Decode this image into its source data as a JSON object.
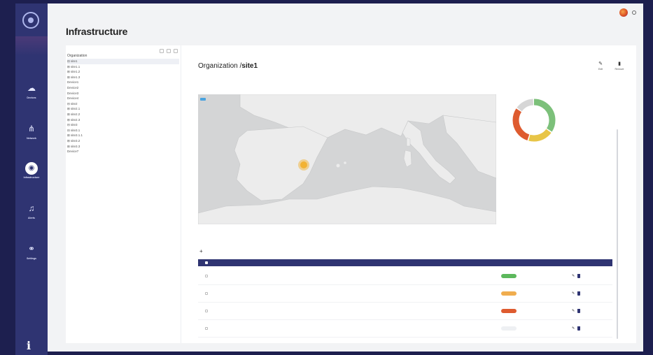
{
  "colors": {
    "sidebar": "#2f3472",
    "background": "#1d1f4f",
    "accent_navy": "#2f3472",
    "status_green": "#5cb85c",
    "status_orange": "#f0ad4e",
    "status_red": "#d9534f",
    "status_gray": "#e5e7eb",
    "donut_green": "#7cc07a",
    "donut_yellow": "#e8c547",
    "donut_red": "#de5b2f",
    "donut_gray": "#d6d6d6",
    "marker": "#f2b233"
  },
  "sidebar": {
    "logo_icon": "atom-icon",
    "items": [
      {
        "label": "Devices",
        "icon": "cloud-icon"
      },
      {
        "label": "Network",
        "icon": "topology-icon"
      },
      {
        "label": "Infrastructure",
        "icon": "globe-icon",
        "active": true
      },
      {
        "label": "Alerts",
        "icon": "bell-icon"
      },
      {
        "label": "Settings",
        "icon": "link-icon"
      }
    ],
    "info_label": "i"
  },
  "page": {
    "title": "Infrastructure"
  },
  "tree": {
    "root": "Organization",
    "items": [
      "⊟ site1",
      "   ⊞ site1.1",
      "   ⊞ site1.2",
      "   ⊞ site1.3",
      "   Device1",
      "   Device2",
      "   Device3",
      "   Device4",
      "⊟ site2",
      "   ⊞ site2.1",
      "   ⊞ site2.2",
      "   ⊞ site2.3",
      "⊟ site3",
      "   ⊟ site3.1",
      "      ⊞ site3.1.1",
      "   ⊞ site3.2",
      "   ⊞ site3.3",
      "Device7"
    ]
  },
  "detail": {
    "title_prefix": "Organization /",
    "title_site": "site1",
    "edit_label": "Edit",
    "remove_label": "Remove"
  }
}
